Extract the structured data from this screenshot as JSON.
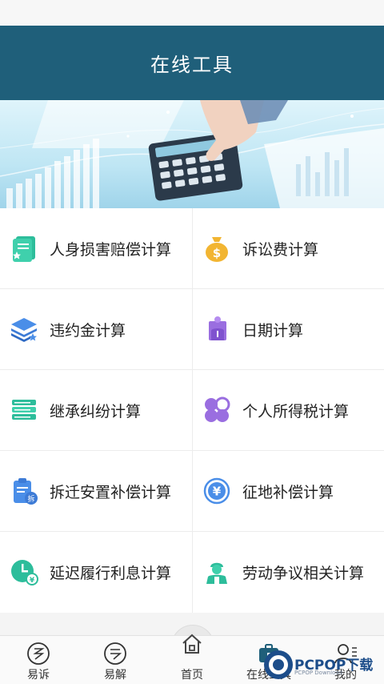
{
  "header": {
    "title": "在线工具"
  },
  "tools": [
    {
      "label": "人身损害赔偿计算",
      "icon": "document-star-icon"
    },
    {
      "label": "诉讼费计算",
      "icon": "money-bag-icon"
    },
    {
      "label": "违约金计算",
      "icon": "layers-star-icon"
    },
    {
      "label": "日期计算",
      "icon": "person-calendar-icon"
    },
    {
      "label": "继承纠纷计算",
      "icon": "book-stack-icon"
    },
    {
      "label": "个人所得税计算",
      "icon": "four-petal-icon"
    },
    {
      "label": "拆迁安置补偿计算",
      "icon": "clipboard-demolish-icon"
    },
    {
      "label": "征地补偿计算",
      "icon": "yen-circle-icon"
    },
    {
      "label": "延迟履行利息计算",
      "icon": "clock-yen-icon"
    },
    {
      "label": "劳动争议相关计算",
      "icon": "worker-icon"
    }
  ],
  "tabbar": {
    "tabs": [
      {
        "label": "易诉",
        "icon": "yisu-icon"
      },
      {
        "label": "易解",
        "icon": "yijie-icon"
      },
      {
        "label": "首页",
        "icon": "home-icon"
      },
      {
        "label": "在线工具",
        "icon": "toolbox-icon"
      },
      {
        "label": "我的",
        "icon": "user-icon"
      }
    ]
  },
  "watermark": {
    "brand": "PCPOP下载",
    "sub": "PCPOP Download"
  },
  "colors": {
    "header_bg": "#1f5f7a",
    "teal": "#2dbd9b",
    "blue": "#4a8ee8",
    "purple": "#9a6ee0",
    "gold": "#f2b532"
  }
}
